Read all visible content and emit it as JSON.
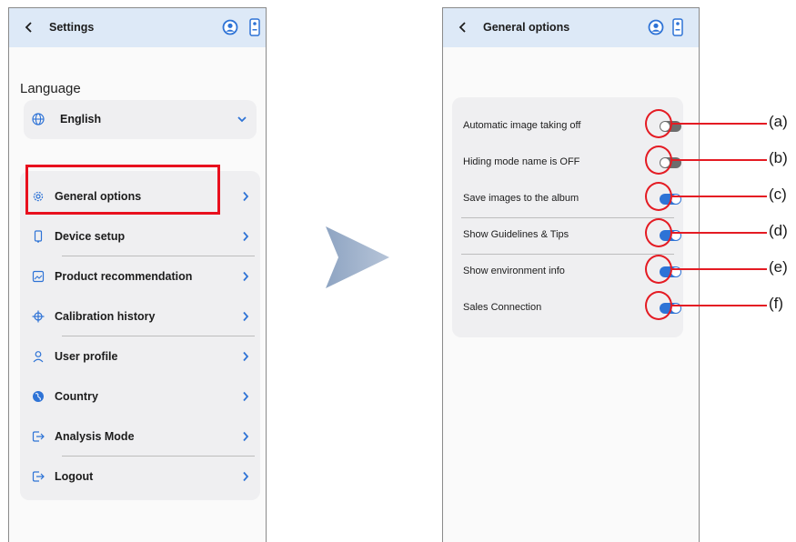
{
  "left_screen": {
    "header": {
      "title": "Settings"
    },
    "icons": {
      "back": "chevron-left-icon",
      "profile": "user-circle-icon",
      "device": "phone-device-icon"
    },
    "language": {
      "title": "Language",
      "selected": "English",
      "icon": "globe-icon"
    },
    "menu": [
      {
        "label": "General options",
        "icon": "gear-icon"
      },
      {
        "label": "Device setup",
        "icon": "device-icon"
      },
      {
        "label": "Product recommendation",
        "icon": "image-icon"
      },
      {
        "label": "Calibration history",
        "icon": "crosshair-icon"
      },
      {
        "label": "User profile",
        "icon": "person-icon"
      },
      {
        "label": "Country",
        "icon": "globe-filled-icon"
      },
      {
        "label": "Analysis Mode",
        "icon": "logout-arrow-icon"
      },
      {
        "label": "Logout",
        "icon": "logout-arrow-icon"
      }
    ],
    "highlighted_item": "General options"
  },
  "right_screen": {
    "header": {
      "title": "General options"
    },
    "options": [
      {
        "label": "Automatic image taking off",
        "state": "off",
        "callout": "(a)"
      },
      {
        "label": "Hiding mode name is OFF",
        "state": "off",
        "callout": "(b)"
      },
      {
        "label": "Save images to the album",
        "state": "on",
        "callout": "(c)"
      },
      {
        "label": "Show Guidelines & Tips",
        "state": "on",
        "callout": "(d)"
      },
      {
        "label": "Show environment info",
        "state": "on",
        "callout": "(e)"
      },
      {
        "label": "Sales Connection",
        "state": "on",
        "callout": "(f)"
      }
    ]
  },
  "colors": {
    "appbar": "#dde9f7",
    "accent_blue": "#2e73d6",
    "toggle_off": "#6d6d6d",
    "highlight_red": "#e8101e",
    "arrow": "#9eb0c8"
  }
}
